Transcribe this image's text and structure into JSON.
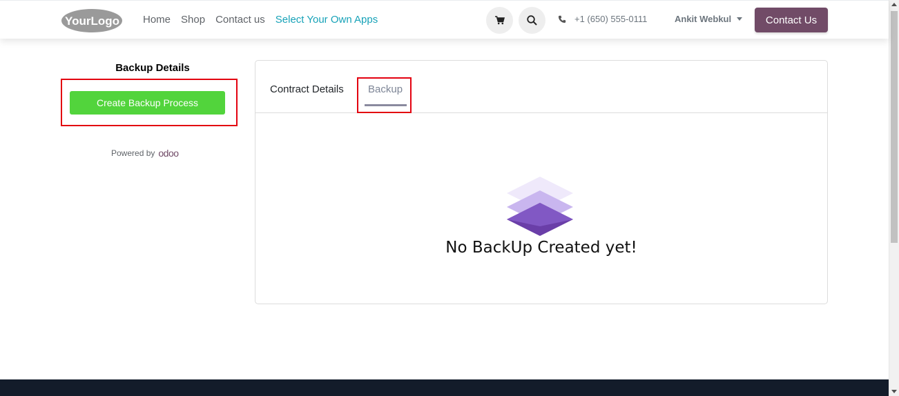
{
  "header": {
    "logo_text": "YourLogo",
    "nav": [
      {
        "label": "Home"
      },
      {
        "label": "Shop"
      },
      {
        "label": "Contact us"
      },
      {
        "label": "Select Your Own Apps"
      }
    ],
    "cart_icon": "cart-icon",
    "search_icon": "search-icon",
    "phone_icon": "phone-icon",
    "phone": "+1 (650) 555-0111",
    "user": "Ankit Webkul",
    "contact_button": "Contact Us"
  },
  "sidebar": {
    "title": "Backup Details",
    "create_button": "Create Backup Process",
    "powered_by": "Powered by",
    "odoo_brand": "odoo"
  },
  "card": {
    "tabs": [
      {
        "label": "Contract Details",
        "active": false
      },
      {
        "label": "Backup",
        "active": true
      }
    ],
    "empty_icon": "stacked-layers-icon",
    "empty_message": "No BackUp Created yet!"
  },
  "colors": {
    "brand": "#714b67",
    "create_button": "#52d43c",
    "accent_link": "#17a2b8",
    "highlight": "#e3000f",
    "footer": "#131c2a"
  }
}
